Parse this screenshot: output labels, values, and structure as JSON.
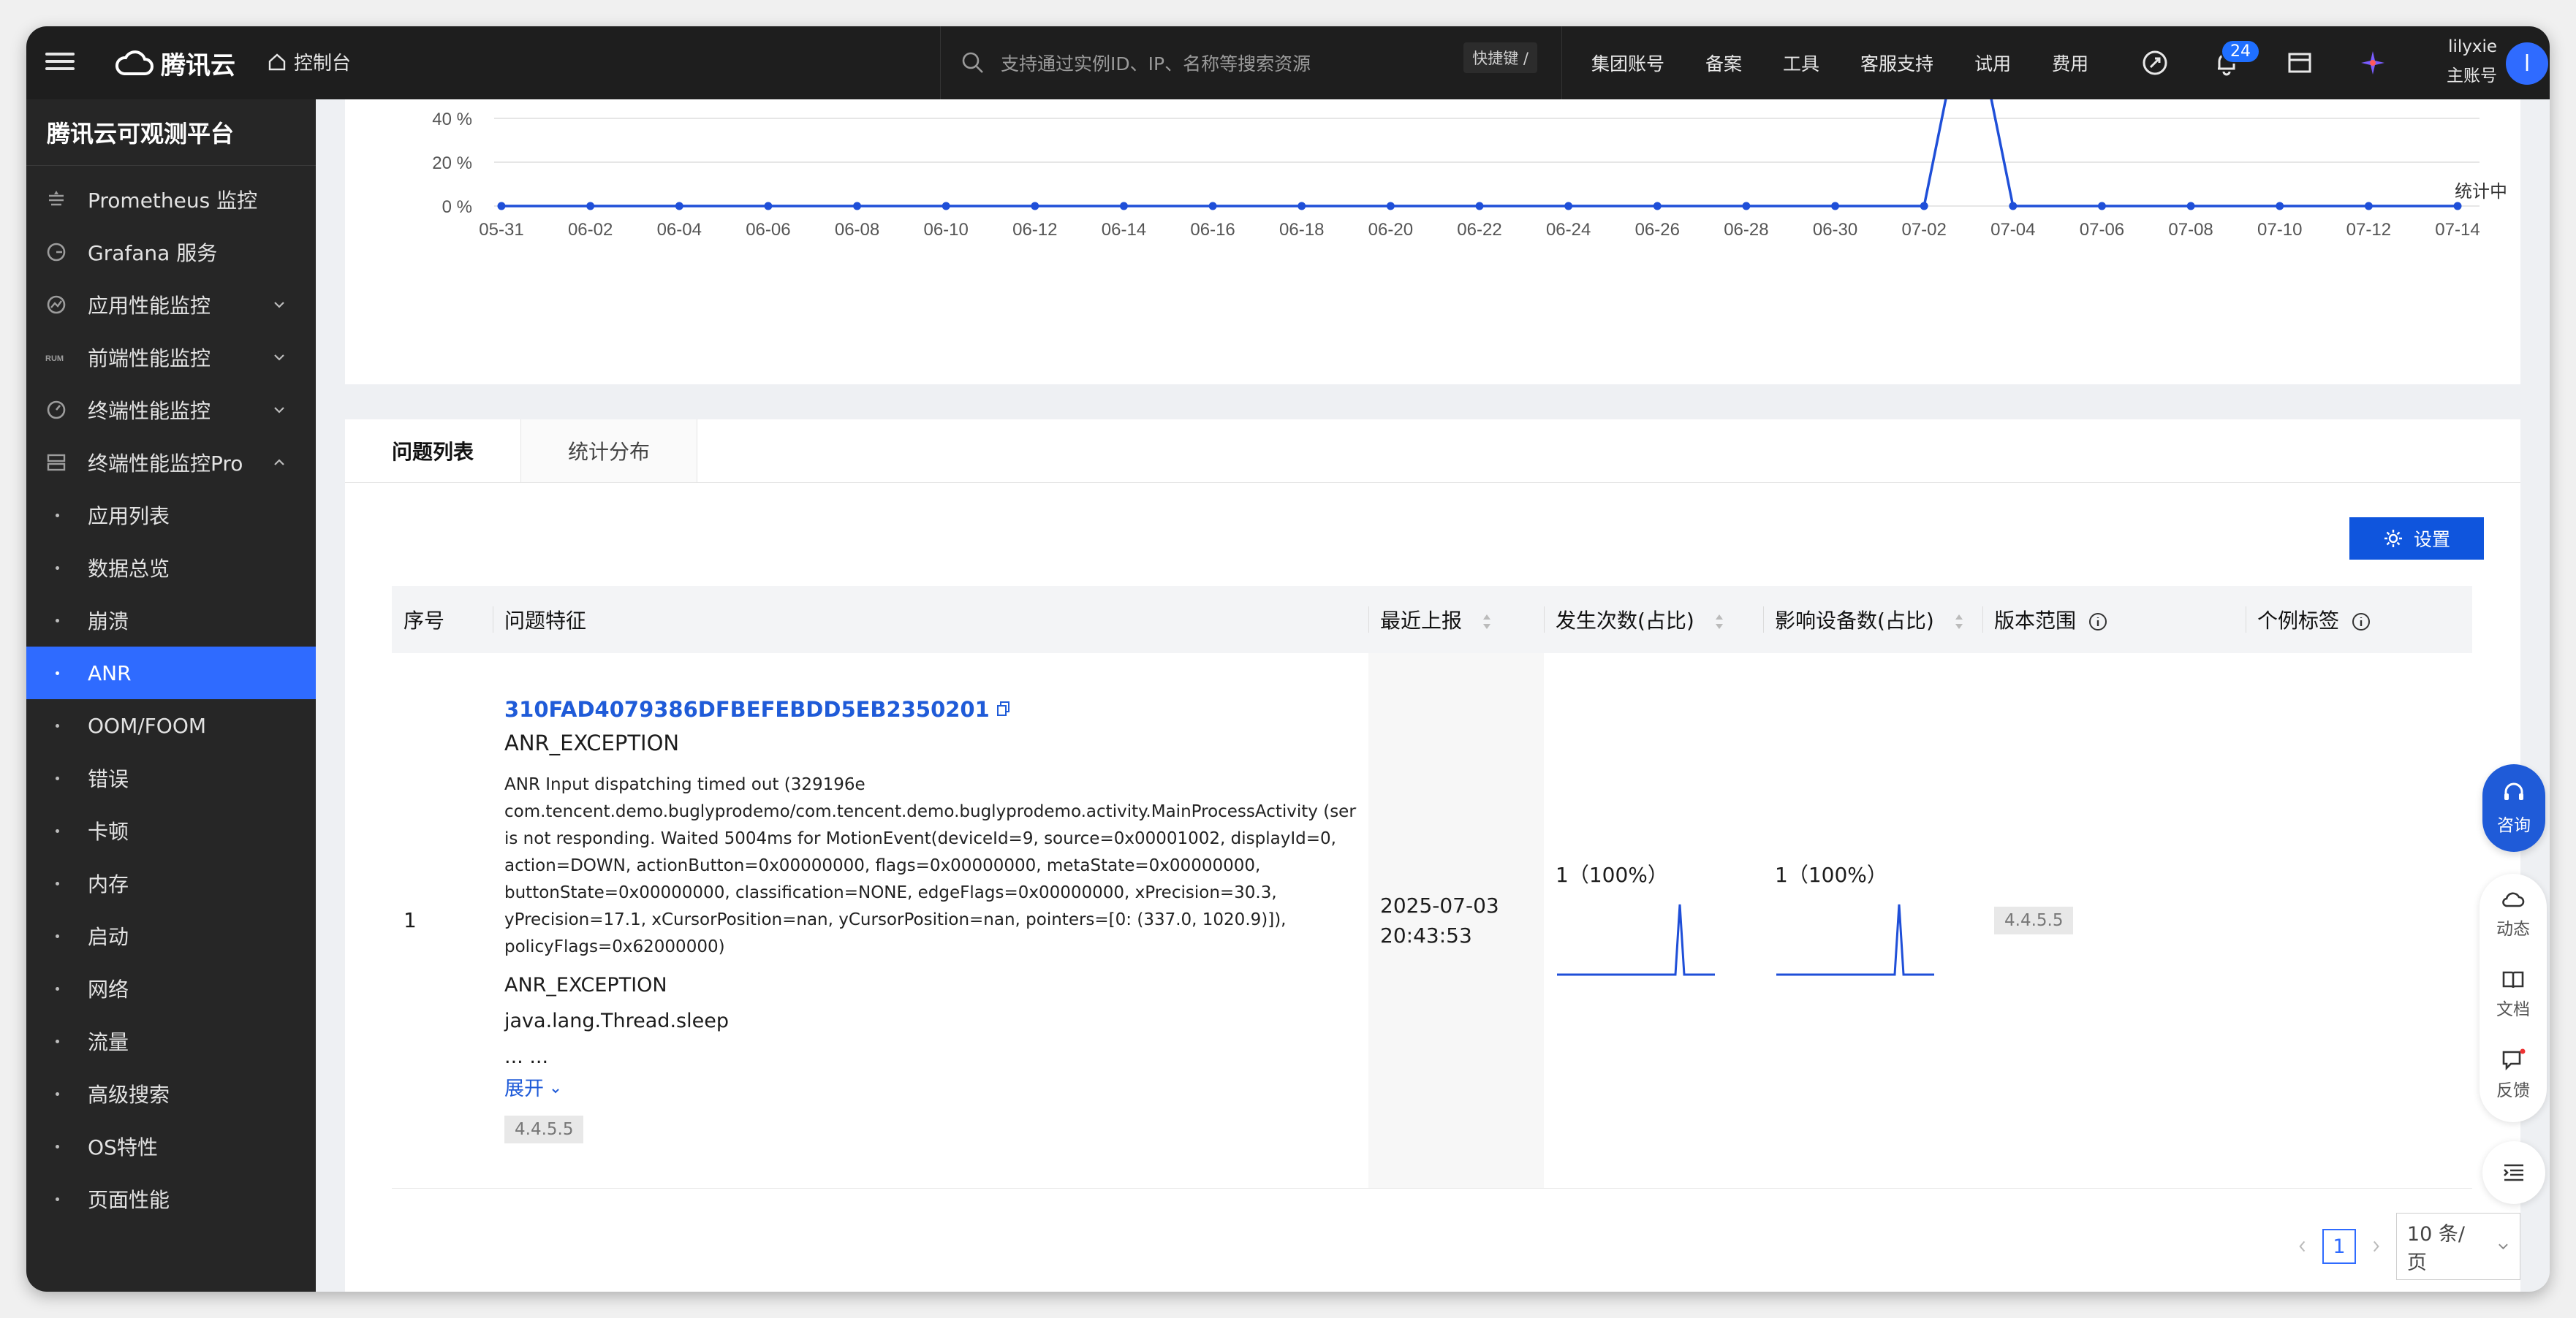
{
  "topbar": {
    "brand": "腾讯云",
    "console": "控制台",
    "search_placeholder": "支持通过实例ID、IP、名称等搜索资源",
    "shortcut": "快捷键 /",
    "nav": [
      "集团账号",
      "备案",
      "工具",
      "客服支持",
      "试用",
      "费用"
    ],
    "notification_count": "24",
    "user_name": "lilyxie",
    "user_role": "主账号",
    "avatar_letter": "l"
  },
  "sidebar": {
    "title": "腾讯云可观测平台",
    "items": [
      {
        "label": "Prometheus 监控",
        "icon": "prometheus-icon"
      },
      {
        "label": "Grafana 服务",
        "icon": "grafana-icon"
      },
      {
        "label": "应用性能监控",
        "icon": "apm-icon"
      },
      {
        "label": "前端性能监控",
        "icon": "rum-icon"
      },
      {
        "label": "终端性能监控",
        "icon": "terminal-monitor-icon"
      },
      {
        "label": "终端性能监控Pro",
        "icon": "terminal-pro-icon"
      }
    ],
    "rum_text": "RUM",
    "sub_items": [
      "应用列表",
      "数据总览",
      "崩溃",
      "ANR",
      "OOM/FOOM",
      "错误",
      "卡顿",
      "内存",
      "启动",
      "网络",
      "流量",
      "高级搜索",
      "OS特性",
      "页面性能"
    ],
    "active_sub": "ANR"
  },
  "chart_data": {
    "type": "line",
    "x": [
      "05-31",
      "06-01",
      "06-02",
      "06-03",
      "06-04",
      "06-05",
      "06-06",
      "06-07",
      "06-08",
      "06-09",
      "06-10",
      "06-11",
      "06-12",
      "06-13",
      "06-14",
      "06-15",
      "06-16",
      "06-17",
      "06-18",
      "06-19",
      "06-20",
      "06-21",
      "06-22",
      "06-23",
      "06-24",
      "06-25",
      "06-26",
      "06-27",
      "06-28",
      "06-29",
      "06-30",
      "07-01",
      "07-02",
      "07-03",
      "07-04",
      "07-05",
      "07-06",
      "07-07",
      "07-08",
      "07-09",
      "07-10",
      "07-11",
      "07-12",
      "07-13",
      "07-14"
    ],
    "tick_labels": [
      "05-31",
      "06-02",
      "06-04",
      "06-06",
      "06-08",
      "06-10",
      "06-12",
      "06-14",
      "06-16",
      "06-18",
      "06-20",
      "06-22",
      "06-24",
      "06-26",
      "06-28",
      "06-30",
      "07-02",
      "07-04",
      "07-06",
      "07-08",
      "07-10",
      "07-12",
      "07-14"
    ],
    "values": [
      0,
      0,
      0,
      0,
      0,
      0,
      0,
      0,
      0,
      0,
      0,
      0,
      0,
      0,
      0,
      0,
      0,
      0,
      0,
      0,
      0,
      0,
      0,
      0,
      0,
      0,
      0,
      0,
      0,
      0,
      0,
      0,
      0,
      100,
      0,
      0,
      0,
      0,
      0,
      0,
      0,
      0,
      0,
      0,
      0
    ],
    "y_ticks": [
      "0 %",
      "20 %",
      "40 %"
    ],
    "annotation": "统计中",
    "color": "#1f4fd8"
  },
  "tabs": [
    "问题列表",
    "统计分布"
  ],
  "settings_label": "设置",
  "table": {
    "headers": [
      "序号",
      "问题特征",
      "最近上报",
      "发生次数(占比)",
      "影响设备数(占比)",
      "版本范围",
      "个例标签"
    ],
    "row": {
      "index": "1",
      "issue_id": "310FAD4079386DFBEFEBDD5EB2350201",
      "issue_type": "ANR_EXCEPTION",
      "desc": [
        "ANR Input dispatching timed out (329196e",
        "com.tencent.demo.buglyprodemo/com.tencent.demo.buglyprodemo.activity.MainProcessActivity (server",
        "is not responding. Waited 5004ms for MotionEvent(deviceId=9, source=0x00001002, displayId=0,",
        "action=DOWN, actionButton=0x00000000, flags=0x00000000, metaState=0x00000000,",
        "buttonState=0x00000000, classification=NONE, edgeFlags=0x00000000, xPrecision=30.3,",
        "yPrecision=17.1, xCursorPosition=nan, yCursorPosition=nan, pointers=[0: (337.0, 1020.9)]),",
        "policyFlags=0x62000000)"
      ],
      "line2": "ANR_EXCEPTION",
      "line3": "java.lang.Thread.sleep",
      "ellipsis": "... ...",
      "expand": "展开",
      "version_tag": "4.4.5.5",
      "time_date": "2025-07-03",
      "time_clock": "20:43:53",
      "occurrences": "1（100%）",
      "devices": "1（100%）",
      "version_range": "4.4.5.5"
    }
  },
  "pager": {
    "current": "1",
    "page_size": "10 条/页"
  },
  "float": {
    "consult": "咨询",
    "items": [
      "动态",
      "文档",
      "反馈"
    ]
  }
}
